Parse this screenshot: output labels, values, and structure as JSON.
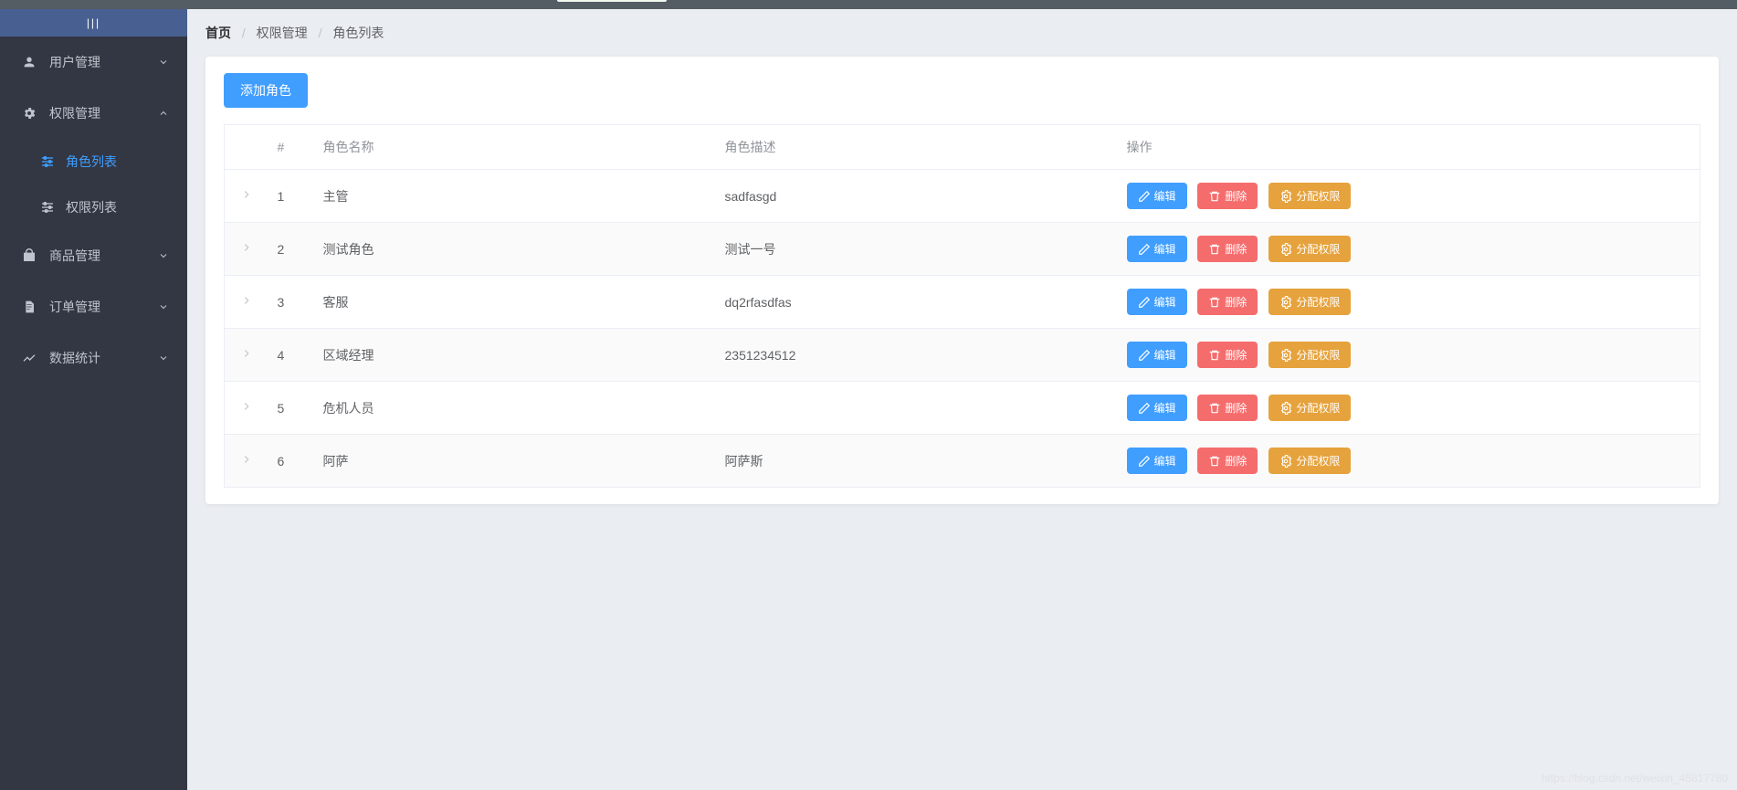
{
  "topbar": {
    "notify_text": ""
  },
  "sidebar": {
    "collapse_label": "|||",
    "items": [
      {
        "icon": "user-icon",
        "label": "用户管理",
        "expanded": false
      },
      {
        "icon": "gear-icon",
        "label": "权限管理",
        "expanded": true,
        "children": [
          {
            "icon": "sliders-icon",
            "label": "角色列表",
            "active": true
          },
          {
            "icon": "sliders-icon",
            "label": "权限列表",
            "active": false
          }
        ]
      },
      {
        "icon": "bag-icon",
        "label": "商品管理",
        "expanded": false
      },
      {
        "icon": "file-icon",
        "label": "订单管理",
        "expanded": false
      },
      {
        "icon": "chart-icon",
        "label": "数据统计",
        "expanded": false
      }
    ]
  },
  "breadcrumb": {
    "home": "首页",
    "level1": "权限管理",
    "level2": "角色列表"
  },
  "buttons": {
    "add_role": "添加角色",
    "edit": "编辑",
    "delete": "删除",
    "assign": "分配权限"
  },
  "table": {
    "headers": {
      "index": "#",
      "name": "角色名称",
      "desc": "角色描述",
      "ops": "操作"
    },
    "rows": [
      {
        "index": "1",
        "name": "主管",
        "desc": "sadfasgd"
      },
      {
        "index": "2",
        "name": "测试角色",
        "desc": "测试一号"
      },
      {
        "index": "3",
        "name": "客服",
        "desc": "dq2rfasdfas"
      },
      {
        "index": "4",
        "name": "区域经理",
        "desc": "2351234512"
      },
      {
        "index": "5",
        "name": "危机人员",
        "desc": ""
      },
      {
        "index": "6",
        "name": "阿萨",
        "desc": "阿萨斯"
      }
    ]
  },
  "watermark": "https://blog.csdn.net/weixin_45817780"
}
